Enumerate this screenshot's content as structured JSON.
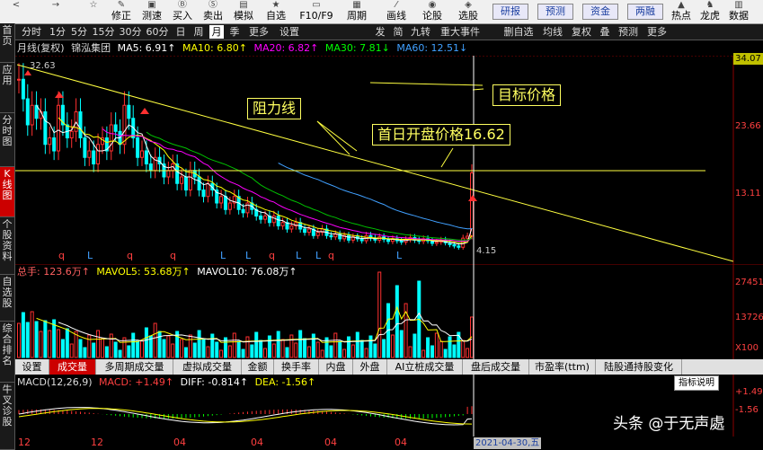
{
  "toolbar": {
    "buttons": [
      {
        "icon": "<",
        "label": ""
      },
      {
        "icon": "→",
        "label": ""
      },
      {
        "icon": "☆",
        "label": ""
      },
      {
        "icon": "✎",
        "label": "修正"
      },
      {
        "icon": "▣",
        "label": "测速"
      },
      {
        "icon": "Ⓑ",
        "label": "买入"
      },
      {
        "icon": "Ⓢ",
        "label": "卖出"
      },
      {
        "icon": "▤",
        "label": "模拟"
      },
      {
        "icon": "★",
        "label": "自选"
      },
      {
        "icon": "▭",
        "label": "F10/F9"
      },
      {
        "icon": "▦",
        "label": "周期"
      },
      {
        "icon": "⁄",
        "label": "画线"
      },
      {
        "icon": "◉",
        "label": "论股"
      },
      {
        "icon": "◈",
        "label": "选股"
      }
    ],
    "boxed": [
      "研报",
      "预测",
      "资金",
      "两融"
    ],
    "right": [
      {
        "icon": "▲",
        "label": "热点"
      },
      {
        "icon": "♞",
        "label": "龙虎"
      },
      {
        "icon": "▥",
        "label": "数据"
      }
    ]
  },
  "leftnav": [
    "首页",
    "应用",
    "分时图",
    "K线图",
    "个股资料",
    "自选股",
    "综合排名",
    "牛叉诊股"
  ],
  "periods": [
    "分时",
    "1分",
    "5分",
    "15分",
    "30分",
    "60分",
    "日",
    "周",
    "月",
    "季",
    "更多",
    "设置"
  ],
  "periodbar_right": [
    "发",
    "简",
    "九转",
    "重大事件",
    "删自选",
    "均线",
    "复权",
    "叠",
    "预测",
    "更多"
  ],
  "price_info": {
    "title": "月线(复权)",
    "name": "锦泓集团",
    "ma5": "MA5: 6.91↑",
    "ma10": "MA10: 6.80↑",
    "ma20": "MA20: 6.82↑",
    "ma30": "MA30: 7.81↓",
    "ma60": "MA60: 12.51↓"
  },
  "price_axis": [
    "34.07",
    "23.66",
    "13.11"
  ],
  "price_marks": {
    "high": "32.63",
    "low": "4.15"
  },
  "markers": [
    "q",
    "L",
    "q",
    "q",
    "L",
    "L",
    "q",
    "L",
    "L",
    "q",
    "L"
  ],
  "annotations": {
    "resistance": "阻力线",
    "target": "目标价格",
    "open_price": "首日开盘价格16.62"
  },
  "volume_info": {
    "total": "总手: 123.6万↑",
    "mavol5": "MAVOL5: 53.68万↑",
    "mavol10": "MAVOL10: 76.08万↑"
  },
  "volume_axis": [
    "27451",
    "13726",
    "X100"
  ],
  "indicator_tabs": [
    "设置",
    "成交量",
    "多周期成交量",
    "虚拟成交量",
    "金额",
    "换手率",
    "内盘",
    "外盘",
    "AI立桩成交量",
    "盘后成交量",
    "市盈率(ttm)",
    "陆股通持股变化"
  ],
  "macd_info": {
    "title": "MACD(12,26,9)",
    "macd": "MACD: +1.49↑",
    "diff": "DIFF: -0.814↑",
    "dea": "DEA: -1.56↑"
  },
  "macd_axis": [
    "+1.49",
    "-1.56"
  ],
  "hint_button": "指标说明",
  "bottom_axis": [
    "12",
    "12",
    "04",
    "04",
    "04",
    "04"
  ],
  "date_label": "2021-04-30,五",
  "watermark": "头条 @于无声處",
  "colors": {
    "up": "#ff3030",
    "down": "#00ffff",
    "ma5": "#ffffff",
    "ma10": "#ffff00",
    "ma20": "#ff00ff",
    "ma30": "#00ff00",
    "ma60": "#40a0ff",
    "axis": "#8a0000"
  }
}
